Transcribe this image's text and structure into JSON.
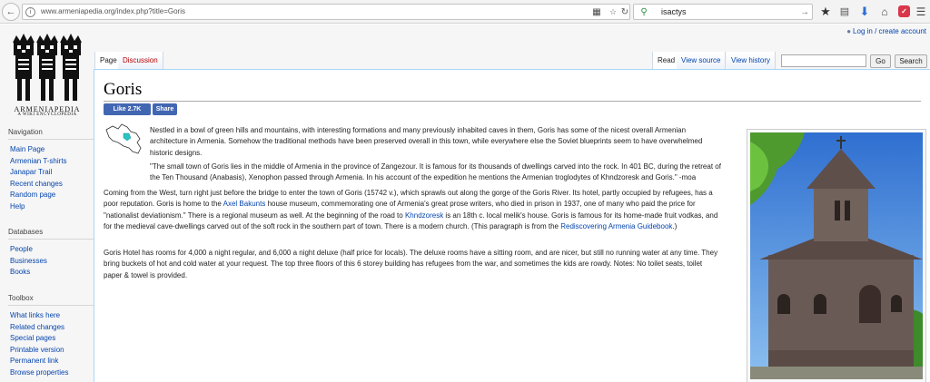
{
  "browser": {
    "url": "www.armeniapedia.org/index.php?title=Goris",
    "search_query": "isactys",
    "colors": {
      "download_icon": "#2f6fd1",
      "pocket_icon": "#d9364a"
    }
  },
  "wiki": {
    "personal_link": "Log in / create account",
    "logo_text": "ARMENIAPEDIA",
    "logo_subtext": "A WIKI ENCYCLOPEDIA",
    "tabs": {
      "page": "Page",
      "discussion": "Discussion",
      "read": "Read",
      "view_source": "View source",
      "view_history": "View history"
    },
    "search": {
      "go": "Go",
      "search": "Search"
    },
    "sidebar": {
      "navigation": {
        "heading": "Navigation",
        "items": [
          "Main Page",
          "Armenian T-shirts",
          "Janapar Trail",
          "Recent changes",
          "Random page",
          "Help"
        ]
      },
      "databases": {
        "heading": "Databases",
        "items": [
          "People",
          "Businesses",
          "Books"
        ]
      },
      "toolbox": {
        "heading": "Toolbox",
        "items": [
          "What links here",
          "Related changes",
          "Special pages",
          "Printable version",
          "Permanent link",
          "Browse properties"
        ]
      }
    },
    "article": {
      "title": "Goris",
      "fb_like": "Like 2.7K",
      "fb_share": "Share",
      "p1": "Nestled in a bowl of green hills and mountains, with interesting formations and many previously inhabited caves in them, Goris has some of the nicest overall Armenian architecture in Armenia. Somehow the traditional methods have been preserved overall in this town, while everywhere else the Soviet blueprints seem to have overwhelmed historic designs.",
      "p2": "\"The small town of Goris lies in the middle of Armenia in the province of Zangezour. It is famous for its thousands of dwellings carved into the rock. In 401 BC, during the retreat of the Ten Thousand (Anabasis), Xenophon passed through Armenia. In his account of the expedition he mentions the Armenian troglodytes of Khndzoresk and Goris.\" -moa",
      "p3": {
        "part1": "Coming from the West, turn right just before the bridge to enter the town of Goris (15742 v.), which sprawls out along the gorge of the Goris River. Its hotel, partly occupied by refugees, has a poor reputation. Goris is home to the ",
        "link1": "Axel Bakunts",
        "part2": " house museum, commemorating one of Armenia's great prose writers, who died in prison in 1937, one of many who paid the price for \"nationalist deviationism.\" There is a regional museum as well. At the beginning of the road to ",
        "link2": "Khndzoresk",
        "part3": " is an 18th c. local melik's house. Goris is famous for its home-made fruit vodkas, and for the medieval cave-dwellings carved out of the soft rock in the southern part of town. There is a modern church. (This paragraph is from the ",
        "link3": "Rediscovering Armenia Guidebook",
        "part4": ".)"
      },
      "p4": "Goris Hotel has rooms for 4,000 a night regular, and 6,000 a night deluxe (half price for locals). The deluxe rooms have a sitting room, and are nicer, but still no running water at any time. They bring buckets of hot and cold water at your request. The top three floors of this 6 storey building has refugees from the war, and sometimes the kids are rowdy. Notes: No toilet seats, toilet paper & towel is provided."
    }
  }
}
